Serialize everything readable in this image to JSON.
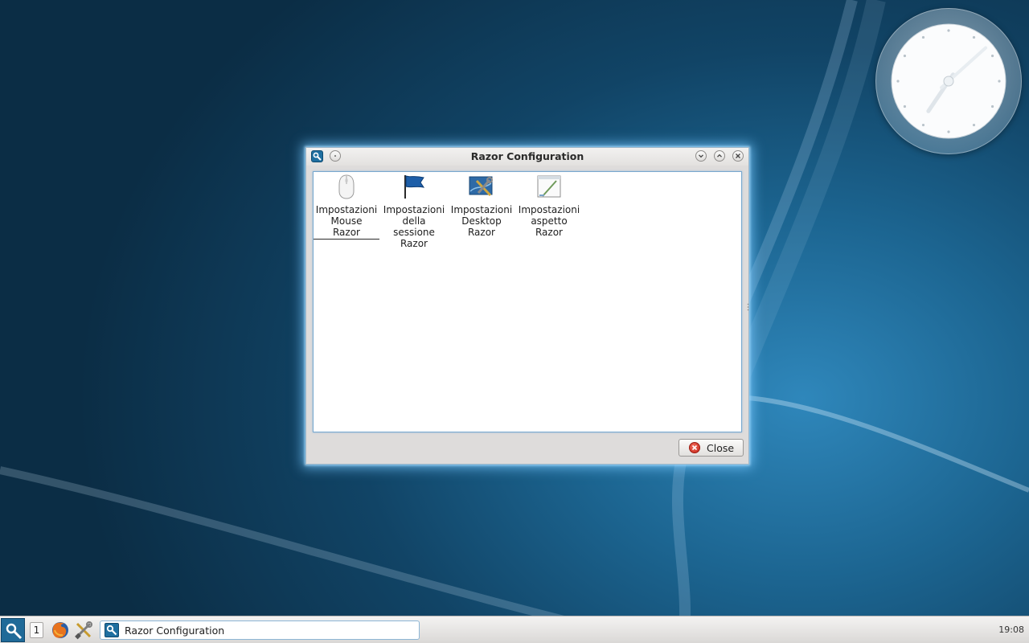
{
  "desktop": {
    "analog_clock": {
      "hour": 19,
      "minute": 8
    }
  },
  "dialog": {
    "title": "Razor Configuration",
    "items": [
      {
        "label": "Impostazioni\nMouse\nRazor",
        "icon": "mouse-icon"
      },
      {
        "label": "Impostazioni\ndella\nsessione\nRazor",
        "icon": "flag-icon"
      },
      {
        "label": "Impostazioni\nDesktop\nRazor",
        "icon": "desktop-settings-icon"
      },
      {
        "label": "Impostazioni\naspetto\nRazor",
        "icon": "appearance-icon"
      }
    ],
    "close_label": "Close"
  },
  "taskbar": {
    "desktop_number": "1",
    "task_title": "Razor Configuration",
    "clock": "19:08"
  },
  "colors": {
    "accent": "#1f6fa0",
    "glow": "#78c8ff",
    "close_red": "#c8261a"
  }
}
